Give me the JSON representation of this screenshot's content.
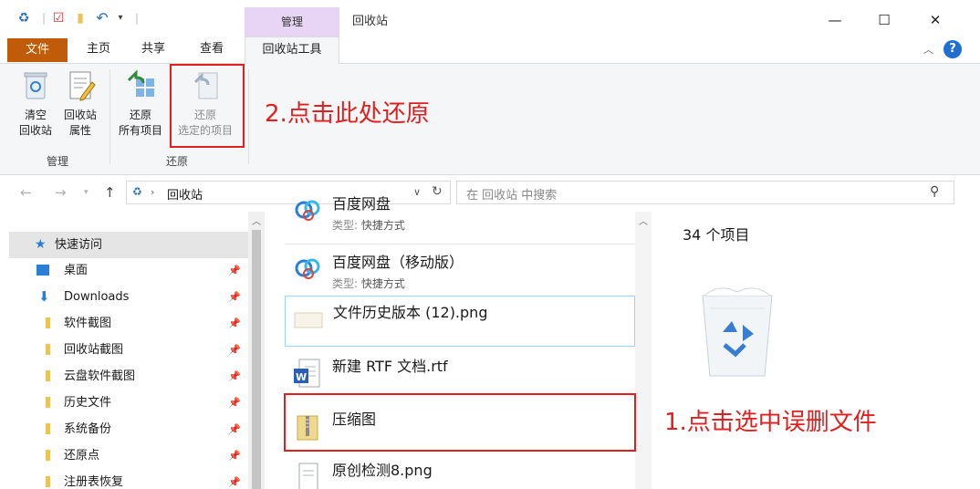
{
  "titlebar": {
    "context_group": "管理",
    "window_title": "回收站",
    "minimize": "—",
    "maximize": "☐",
    "close": "✕"
  },
  "tabs": {
    "file": "文件",
    "home": "主页",
    "share": "共享",
    "view": "查看",
    "recycle_tools": "回收站工具",
    "help": "?"
  },
  "ribbon": {
    "empty_recycle": [
      "清空",
      "回收站"
    ],
    "recycle_properties": [
      "回收站",
      "属性"
    ],
    "restore_all": [
      "还原",
      "所有项目"
    ],
    "restore_selected": [
      "还原",
      "选定的项目"
    ],
    "group_manage": "管理",
    "group_restore": "还原"
  },
  "address": {
    "path": "回收站",
    "search_placeholder": "在 回收站 中搜索"
  },
  "nav": {
    "quick_access": "快速访问",
    "items": [
      {
        "label": "桌面",
        "icon": "desktop-icon"
      },
      {
        "label": "Downloads",
        "icon": "download-icon"
      },
      {
        "label": "软件截图",
        "icon": "folder-icon"
      },
      {
        "label": "回收站截图",
        "icon": "folder-icon"
      },
      {
        "label": "云盘软件截图",
        "icon": "folder-icon"
      },
      {
        "label": "历史文件",
        "icon": "folder-icon"
      },
      {
        "label": "系统备份",
        "icon": "folder-icon"
      },
      {
        "label": "还原点",
        "icon": "folder-icon"
      },
      {
        "label": "注册表恢复",
        "icon": "folder-icon"
      }
    ]
  },
  "files": [
    {
      "name": "百度网盘",
      "type_label": "类型:",
      "type_value": "快捷方式",
      "icon": "baidu-netdisk-icon"
    },
    {
      "name": "百度网盘（移动版）",
      "type_label": "类型:",
      "type_value": "快捷方式",
      "icon": "baidu-netdisk-icon"
    },
    {
      "name": "文件历史版本 (12).png",
      "icon": "image-file-icon"
    },
    {
      "name": "新建 RTF 文档.rtf",
      "icon": "word-file-icon"
    },
    {
      "name": "压缩图",
      "icon": "folder-icon"
    },
    {
      "name": "原创检测8.png",
      "icon": "image-file-icon"
    }
  ],
  "details": {
    "count": "34 个项目"
  },
  "annotations": {
    "step2": "2.点击此处还原",
    "step1": "1.点击选中误删文件"
  },
  "colors": {
    "file_tab": "#c05b09",
    "context_group": "#e8d4f5",
    "annotation": "#e02020",
    "selection": "#cce8ff"
  }
}
